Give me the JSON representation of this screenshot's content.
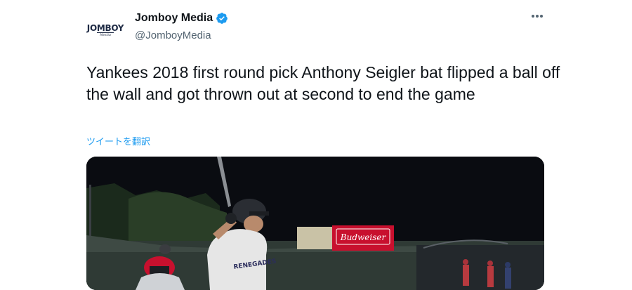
{
  "author": {
    "avatar_text": "JOMBOY",
    "avatar_subtext": "Media",
    "display_name": "Jomboy Media",
    "handle": "@JomboyMedia",
    "verified": true,
    "verified_icon": "verified-badge-icon",
    "verified_color": "#1d9bf0"
  },
  "menu": {
    "more_icon": "more-options-icon"
  },
  "tweet": {
    "text": "Yankees 2018 first round pick Anthony Seigler bat flipped a ball off the wall and got thrown out at second to end the game",
    "translate_link": "ツイートを翻訳"
  },
  "media": {
    "type": "video-thumbnail",
    "jersey_text": "RENEGADES",
    "billboard_text": "Budweiser"
  },
  "colors": {
    "text_primary": "#0f1419",
    "text_secondary": "#536471",
    "link": "#1d9bf0",
    "billboard_red": "#c8102e"
  }
}
